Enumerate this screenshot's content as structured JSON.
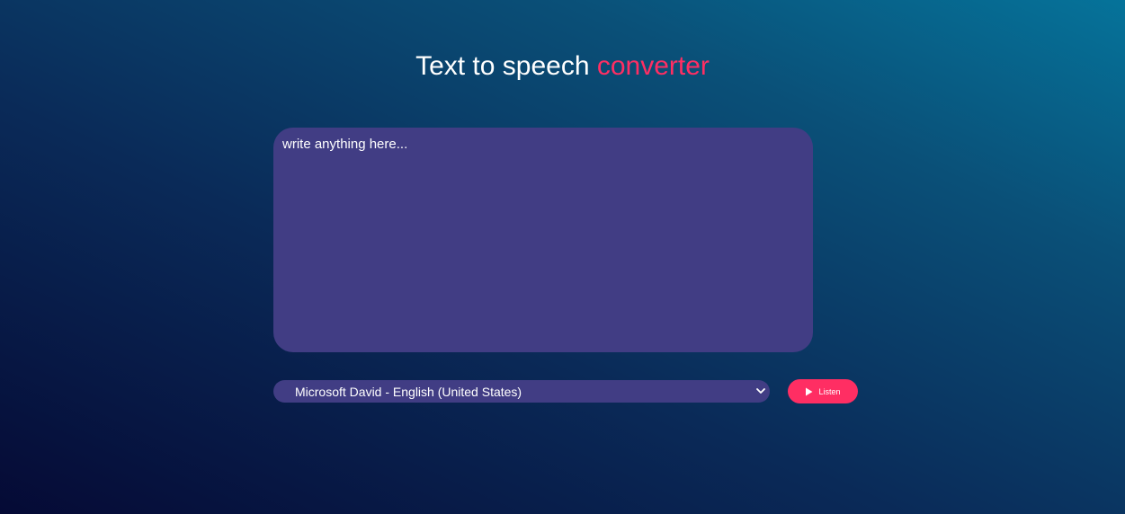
{
  "header": {
    "title_main": "Text to speech",
    "title_accent": "converter"
  },
  "editor": {
    "placeholder": "write anything here...",
    "value": ""
  },
  "voice_select": {
    "selected": "Microsoft David - English (United States)",
    "icon": "chevron-down-icon"
  },
  "listen_button": {
    "label": "Listen",
    "icon": "play-icon"
  },
  "colors": {
    "accent": "#ff2e63",
    "panel": "#413d84",
    "text": "#ffffff"
  }
}
